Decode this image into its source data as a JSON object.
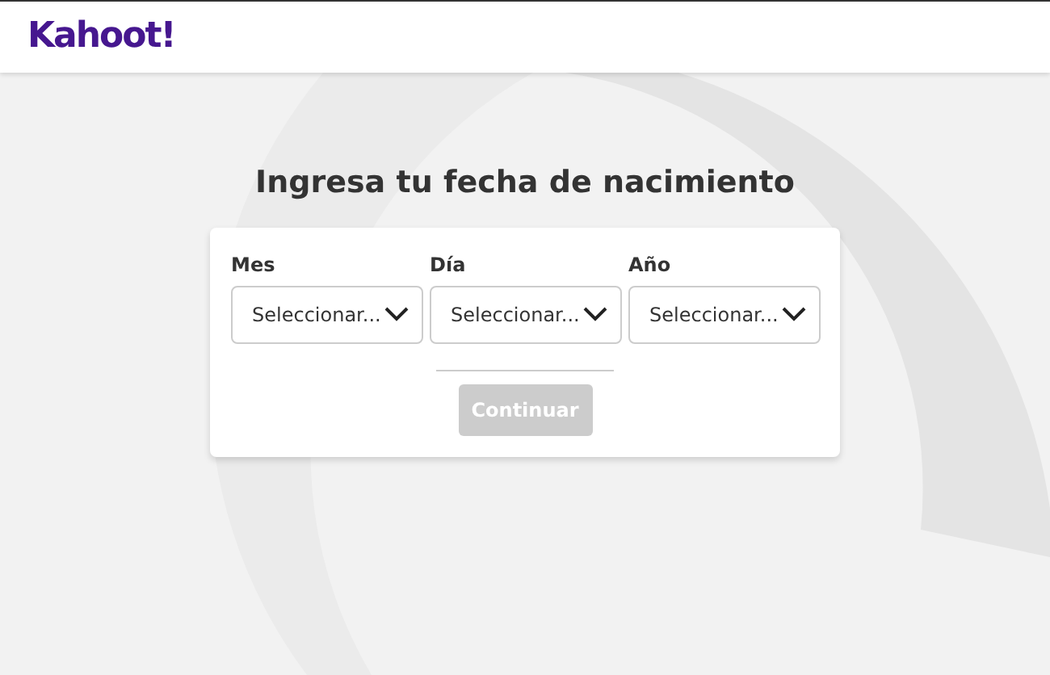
{
  "header": {
    "logo": "Kahoot!"
  },
  "title": "Ingresa tu fecha de nacimiento",
  "fields": [
    {
      "label": "Mes",
      "value": "Seleccionar..."
    },
    {
      "label": "Día",
      "value": "Seleccionar..."
    },
    {
      "label": "Año",
      "value": "Seleccionar..."
    }
  ],
  "button": {
    "label": "Continuar",
    "disabled": true
  }
}
